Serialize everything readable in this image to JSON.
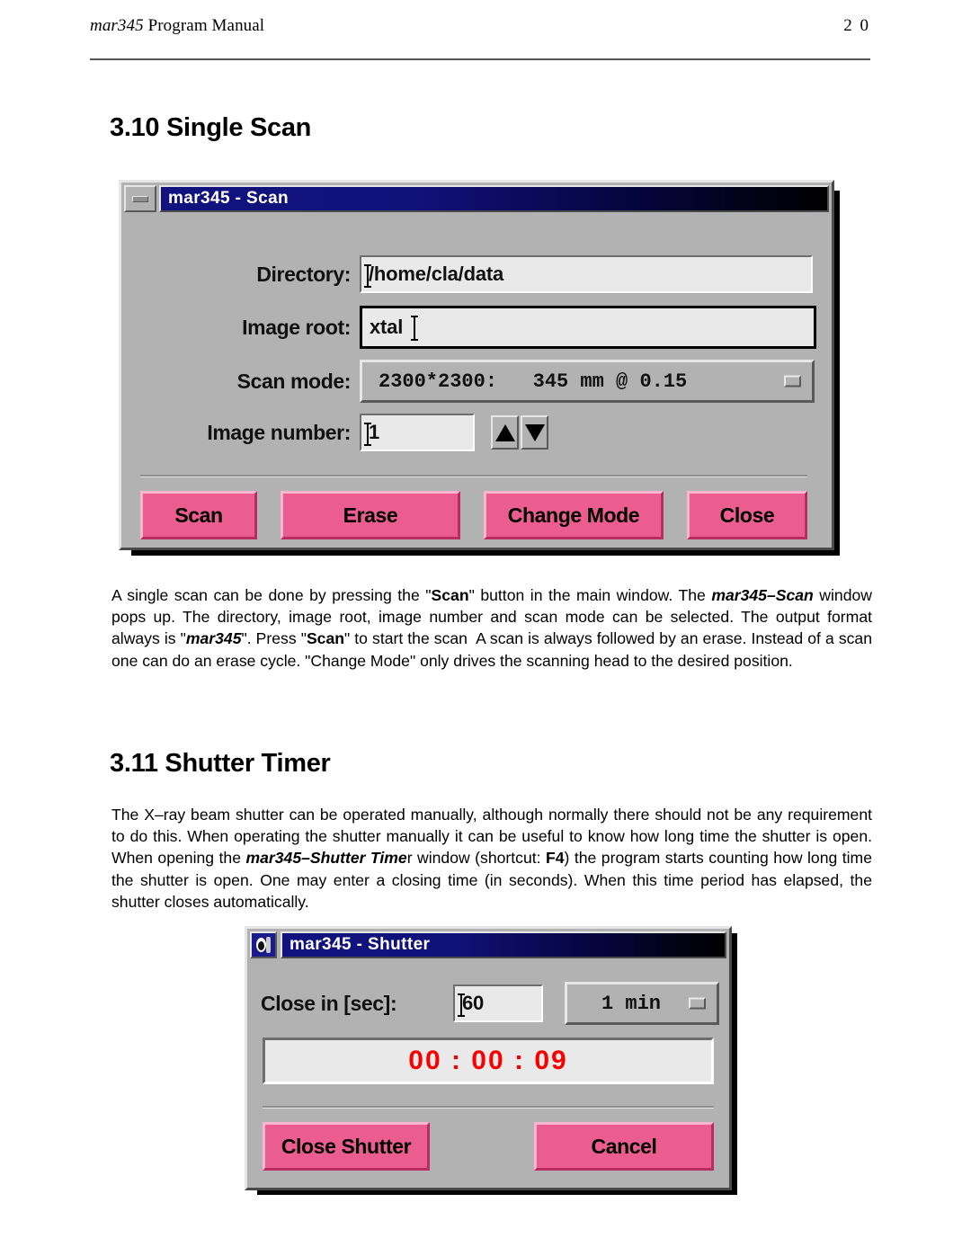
{
  "page": {
    "header_title_italic": "mar345",
    "header_title_rest": " Program Manual",
    "page_number": "2 0"
  },
  "sections": {
    "scan": {
      "heading": "3.10 Single Scan",
      "paragraph_html": "A single scan can be done by pressing the \"<b>Scan</b>\" button in the main window. The <span class=\"bi\">mar345&#8211;Scan</span> window pops up. The directory, image root, image number and scan mode can be selected. The output format always is \"<span class=\"bi\">mar345</span>\". Press \"<b>Scan</b>\" to start the scan&nbsp; A scan is always followed by an erase. Instead of a scan one can do an erase cycle. \"Change Mode\" only drives the scanning head to the desired position."
    },
    "shutter": {
      "heading": "3.11 Shutter Timer",
      "paragraph_html": "The X&#8211;ray beam shutter can be operated manually, although normally there should not be any requirement to do this. When operating the shutter manually it can be useful to know how long time the shutter is open. When opening the <span class=\"bi\">mar345&#8211;Shutter Time</span>r window (shortcut: <b>F4</b>) the program starts counting how long time the shutter is open. One may enter a closing time (in seconds). When this time period has elapsed, the shutter closes automatically."
    }
  },
  "scan_dialog": {
    "title": "mar345 - Scan",
    "minimize_icon": "minimize-icon",
    "fields": {
      "directory": {
        "label": "Directory:",
        "value": "/home/cla/data"
      },
      "image_root": {
        "label": "Image root:",
        "value": "xtal",
        "focused": true
      },
      "scan_mode": {
        "label": "Scan mode:",
        "value": "2300*2300:   345 mm @ 0.15"
      },
      "image_number": {
        "label": "Image number:",
        "value": "1",
        "increment_icon": "triangle-up-icon",
        "decrement_icon": "triangle-down-icon"
      }
    },
    "buttons": [
      {
        "label": "Scan"
      },
      {
        "label": "Erase"
      },
      {
        "label": "Change Mode"
      },
      {
        "label": "Close"
      }
    ]
  },
  "shutter_dialog": {
    "title": "mar345 - Shutter",
    "app_icon": "image-plate-icon",
    "fields": {
      "close_in": {
        "label": "Close in [sec]:",
        "value": "60"
      },
      "preset": {
        "value": "1 min"
      }
    },
    "timer": {
      "value": "00 : 00 : 09"
    },
    "buttons": [
      {
        "label": "Close Shutter"
      },
      {
        "label": "Cancel"
      }
    ]
  },
  "colors": {
    "dialog_face": "#b2b2b2",
    "button_pink": "#ea5d8e",
    "titlebar_blue": "#12127f",
    "timer_red": "#f60000",
    "field_bg": "#e9e9e9"
  }
}
